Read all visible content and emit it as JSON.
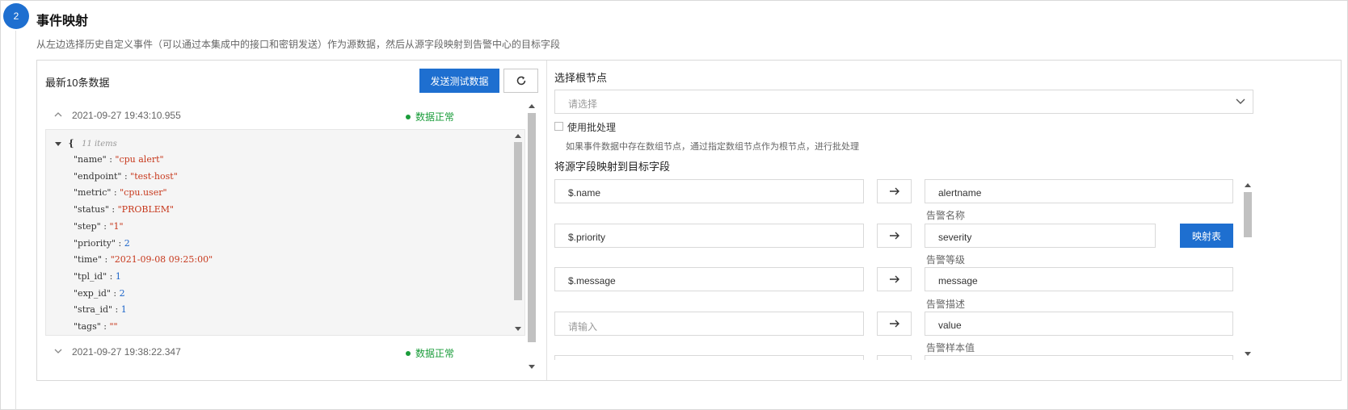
{
  "step": {
    "number": "2",
    "title": "事件映射",
    "description": "从左边选择历史自定义事件（可以通过本集成中的接口和密钥发送）作为源数据，然后从源字段映射到告警中心的目标字段"
  },
  "left": {
    "title": "最新10条数据",
    "send_button": "发送测试数据",
    "refresh_icon": "refresh-icon",
    "records": [
      {
        "timestamp": "2021-09-27 19:43:10.955",
        "status": "数据正常",
        "expanded": true
      },
      {
        "timestamp": "2021-09-27 19:38:22.347",
        "status": "数据正常",
        "expanded": false
      }
    ],
    "json": {
      "open_brace": "{",
      "items_count": "11 items",
      "lines": [
        {
          "key": "\"name\"",
          "sep": " : ",
          "value": "\"cpu alert\"",
          "kind": "string"
        },
        {
          "key": "\"endpoint\"",
          "sep": " : ",
          "value": "\"test-host\"",
          "kind": "string"
        },
        {
          "key": "\"metric\"",
          "sep": " : ",
          "value": "\"cpu.user\"",
          "kind": "string"
        },
        {
          "key": "\"status\"",
          "sep": " : ",
          "value": "\"PROBLEM\"",
          "kind": "string"
        },
        {
          "key": "\"step\"",
          "sep": " : ",
          "value": "\"1\"",
          "kind": "string"
        },
        {
          "key": "\"priority\"",
          "sep": " : ",
          "value": "2",
          "kind": "number"
        },
        {
          "key": "\"time\"",
          "sep": " : ",
          "value": "\"2021-09-08 09:25:00\"",
          "kind": "string"
        },
        {
          "key": "\"tpl_id\"",
          "sep": " : ",
          "value": "1",
          "kind": "number"
        },
        {
          "key": "\"exp_id\"",
          "sep": " : ",
          "value": "2",
          "kind": "number"
        },
        {
          "key": "\"stra_id\"",
          "sep": " : ",
          "value": "1",
          "kind": "number"
        },
        {
          "key": "\"tags\"",
          "sep": " : ",
          "value": "\"\"",
          "kind": "string"
        }
      ]
    }
  },
  "right": {
    "root_label": "选择根节点",
    "root_placeholder": "请选择",
    "batch_label": "使用批处理",
    "batch_hint": "如果事件数据中存在数组节点，通过指定数组节点作为根节点，进行批处理",
    "mapping_title": "将源字段映射到目标字段",
    "map_table_button": "映射表",
    "mappings": [
      {
        "source": "$.name",
        "source_placeholder": false,
        "target": "alertname",
        "target_label": "告警名称"
      },
      {
        "source": "$.priority",
        "source_placeholder": false,
        "target": "severity",
        "target_label": "告警等级"
      },
      {
        "source": "$.message",
        "source_placeholder": false,
        "target": "message",
        "target_label": "告警描述"
      },
      {
        "source": "请输入",
        "source_placeholder": true,
        "target": "value",
        "target_label": "告警样本值"
      }
    ]
  },
  "colors": {
    "primary": "#1e6fd0",
    "ok": "#1a9c3a",
    "json_string": "#c7381c",
    "json_number": "#1b64c9"
  }
}
